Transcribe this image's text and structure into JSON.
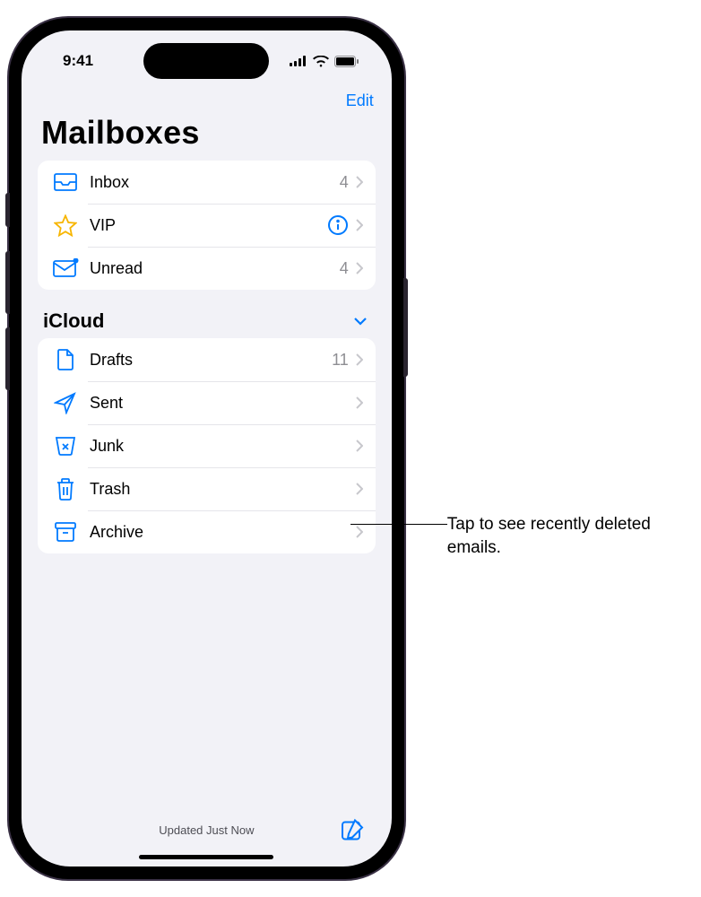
{
  "status": {
    "time": "9:41"
  },
  "nav": {
    "edit": "Edit"
  },
  "title": "Mailboxes",
  "smart": {
    "inbox": {
      "label": "Inbox",
      "count": "4"
    },
    "vip": {
      "label": "VIP"
    },
    "unread": {
      "label": "Unread",
      "count": "4"
    }
  },
  "account": {
    "name": "iCloud",
    "drafts": {
      "label": "Drafts",
      "count": "11"
    },
    "sent": {
      "label": "Sent"
    },
    "junk": {
      "label": "Junk"
    },
    "trash": {
      "label": "Trash"
    },
    "archive": {
      "label": "Archive"
    }
  },
  "footer": {
    "updated": "Updated Just Now"
  },
  "callout": {
    "text": "Tap to see recently deleted emails."
  },
  "colors": {
    "tint": "#007aff",
    "gray": "#8e8e93"
  }
}
